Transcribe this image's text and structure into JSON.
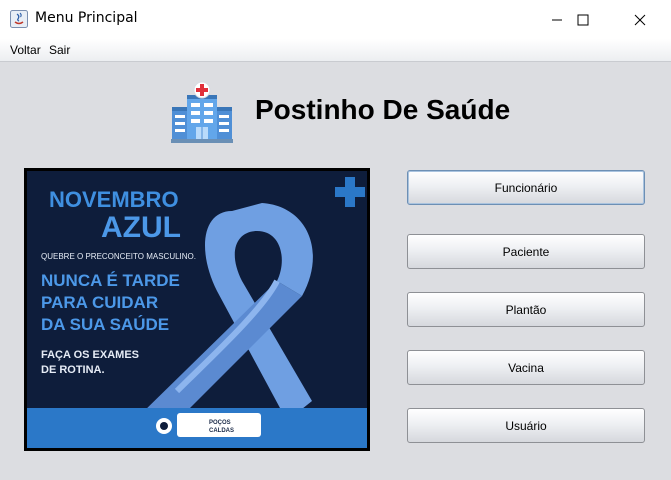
{
  "window": {
    "title": "Menu Principal"
  },
  "menu": {
    "items": [
      "Voltar",
      "Sair"
    ]
  },
  "header": {
    "title": "Postinho De Saúde",
    "icon": "hospital-icon"
  },
  "banner": {
    "line1": "NOVEMBRO",
    "line2": "AZUL",
    "tagline": "QUEBRE O PRECONCEITO MASCULINO.",
    "message": [
      "NUNCA É TARDE",
      "PARA CUIDAR",
      "DA SUA SAÚDE"
    ],
    "call": [
      "FAÇA OS EXAMES",
      "DE ROTINA."
    ],
    "footer_logo": [
      "POÇOS",
      "CALDAS"
    ],
    "colors": {
      "background": "#0e1d3b",
      "ribbon": "#6f9fe2",
      "accent": "#2b78c8"
    }
  },
  "buttons": [
    {
      "label": "Funcionário"
    },
    {
      "label": "Paciente"
    },
    {
      "label": "Plantão"
    },
    {
      "label": "Vacina"
    },
    {
      "label": "Usuário"
    }
  ]
}
